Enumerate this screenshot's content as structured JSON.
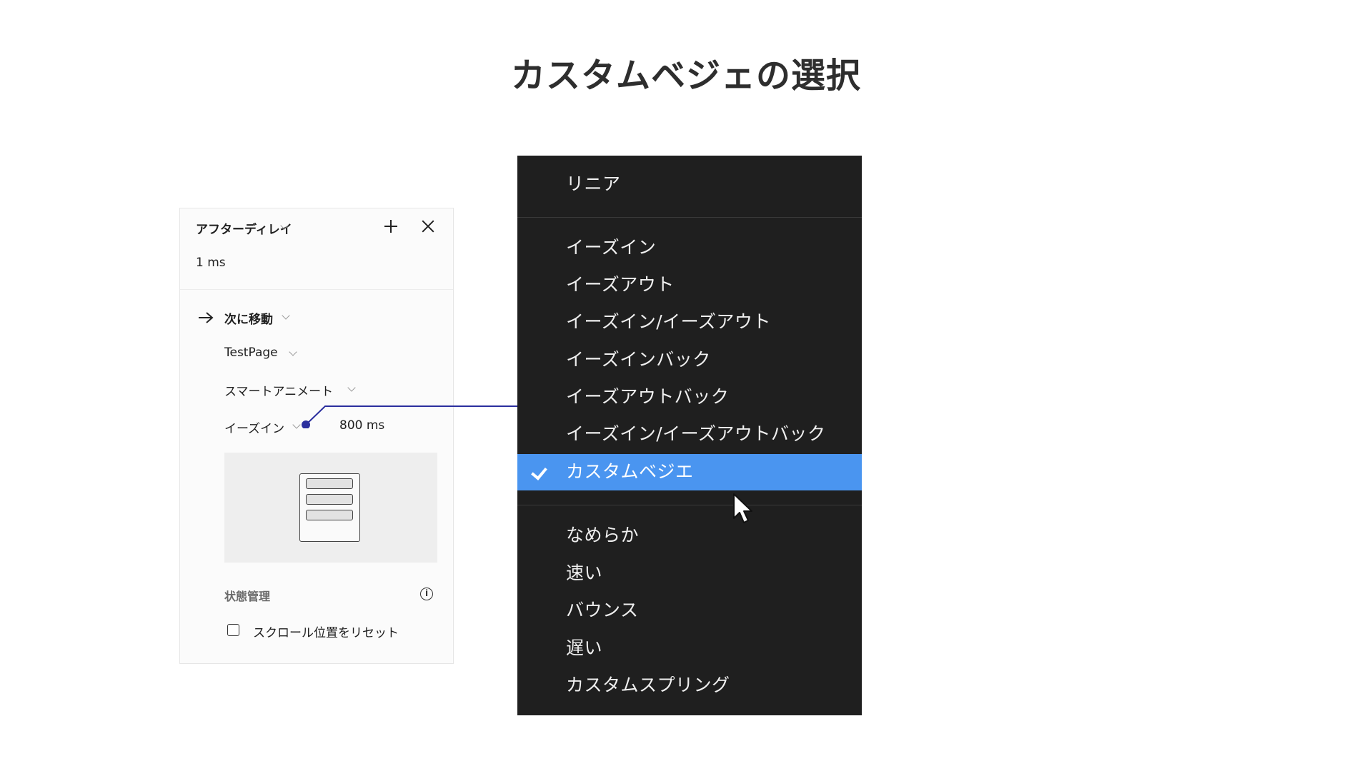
{
  "title": "カスタムベジェの選択",
  "panel": {
    "header_label": "アフターディレイ",
    "delay_value": "1 ms",
    "action_label": "次に移動",
    "destination": "TestPage",
    "animation": "スマートアニメート",
    "easing": "イーズイン",
    "duration": "800 ms",
    "state_label": "状態管理",
    "reset_scroll_label": "スクロール位置をリセット",
    "reset_scroll_checked": false
  },
  "menu": {
    "group1": [
      "リニア"
    ],
    "group2": [
      "イーズイン",
      "イーズアウト",
      "イーズイン/イーズアウト",
      "イーズインバック",
      "イーズアウトバック",
      "イーズイン/イーズアウトバック",
      "カスタムベジエ"
    ],
    "group3": [
      "なめらか",
      "速い",
      "バウンス",
      "遅い",
      "カスタムスプリング"
    ],
    "selected": "カスタムベジエ"
  },
  "colors": {
    "menu_bg": "#1f1f1f",
    "selected_bg": "#4a95f0",
    "connector": "#2b2f9e"
  }
}
